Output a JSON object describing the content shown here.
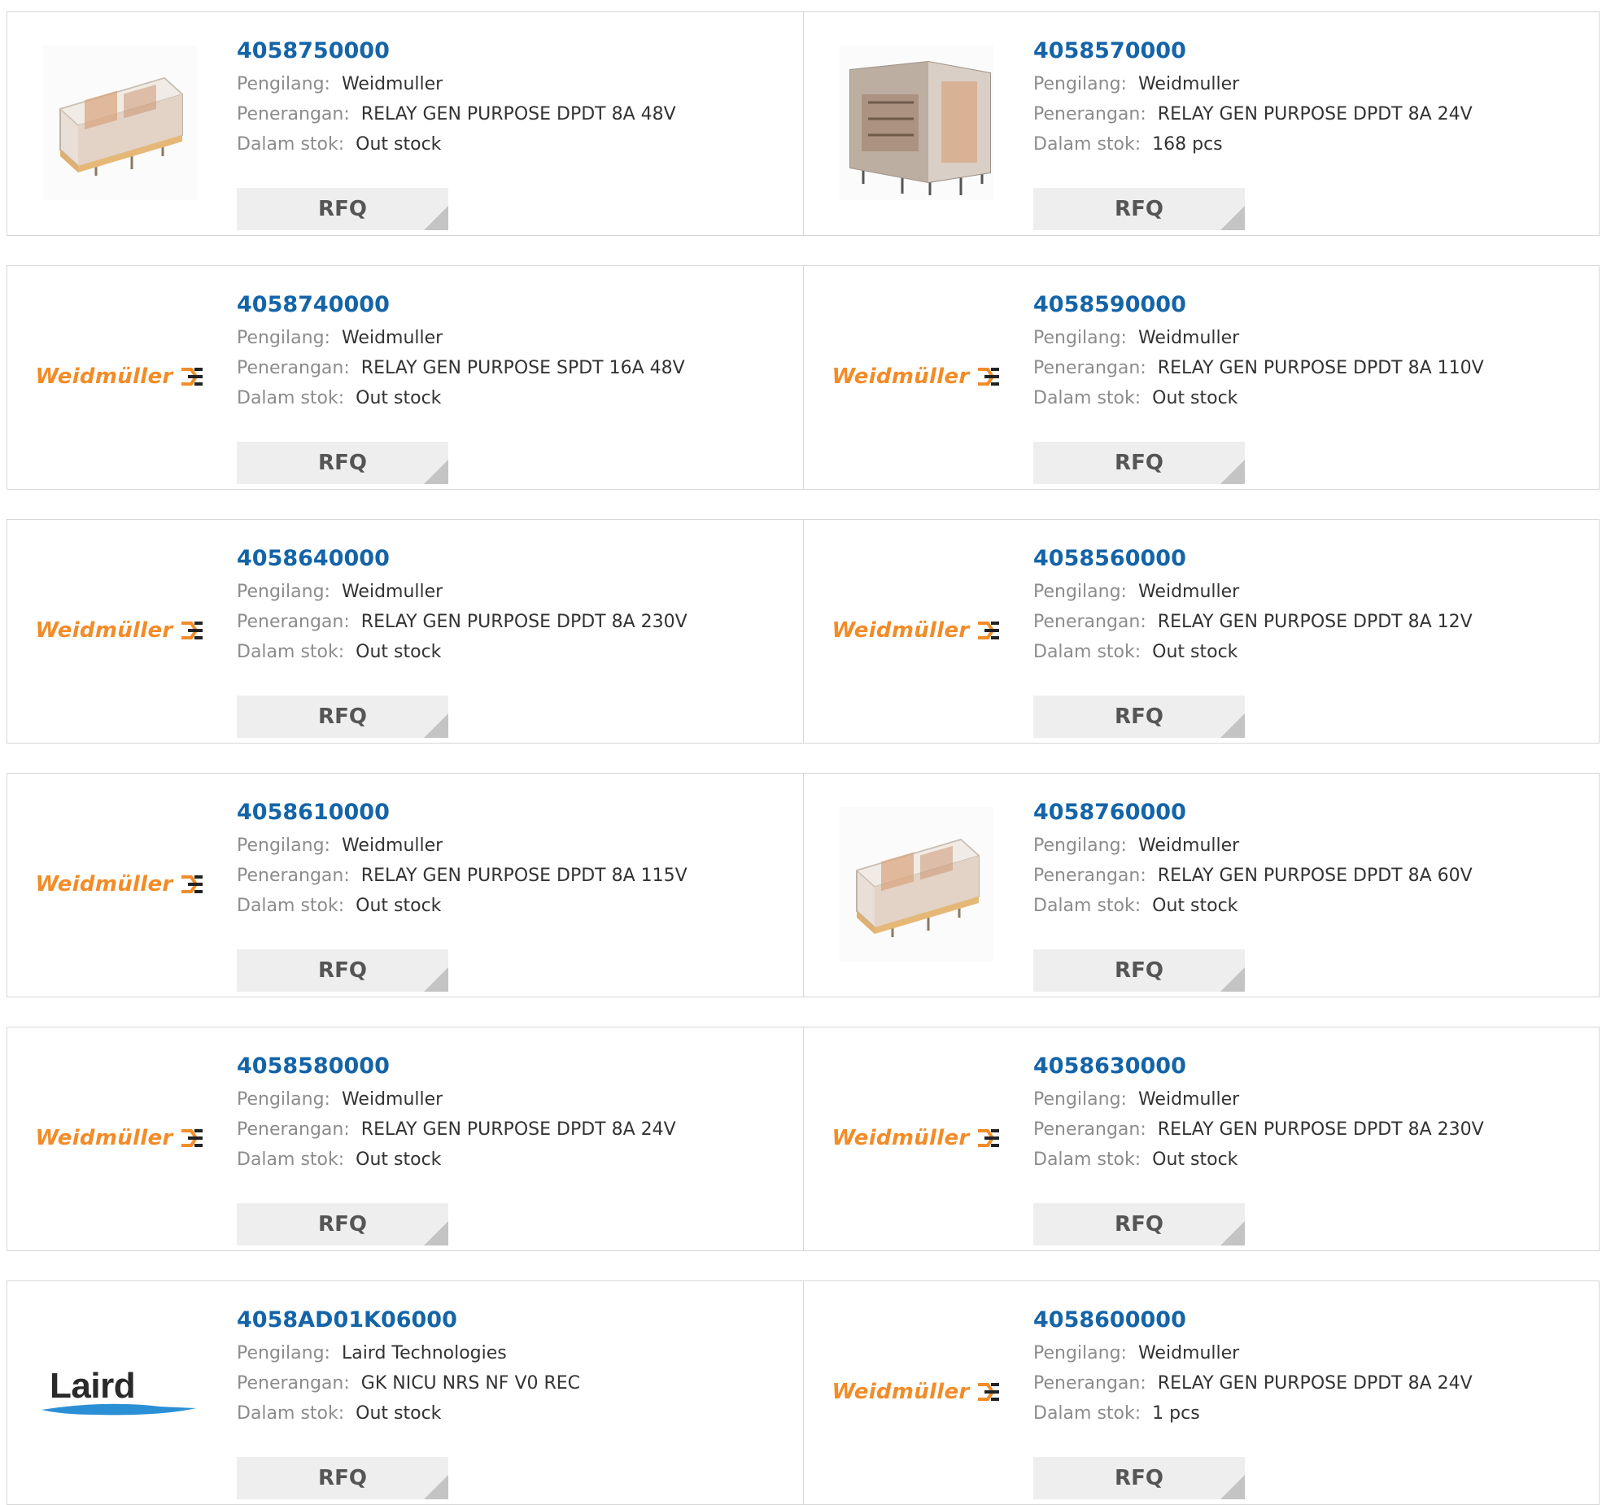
{
  "labels": {
    "manufacturer": "Pengilang:",
    "description": "Penerangan:",
    "stock": "Dalam stok:",
    "rfq": "RFQ"
  },
  "colors": {
    "part_link": "#1464a8",
    "weidmuller_orange": "#f28c28",
    "laird_swoosh": "#2b8fd6"
  },
  "logos": {
    "weidmuller": "Weidmüller",
    "laird": "Laird"
  },
  "products": [
    {
      "part": "4058750000",
      "manufacturer": "Weidmuller",
      "description": "RELAY GEN PURPOSE DPDT 8A 48V",
      "stock": "Out stock",
      "image": "relay-photo"
    },
    {
      "part": "4058570000",
      "manufacturer": "Weidmuller",
      "description": "RELAY GEN PURPOSE DPDT 8A 24V",
      "stock": "168 pcs",
      "image": "relay-photo-front"
    },
    {
      "part": "4058740000",
      "manufacturer": "Weidmuller",
      "description": "RELAY GEN PURPOSE SPDT 16A 48V",
      "stock": "Out stock",
      "image": "weidmuller-logo"
    },
    {
      "part": "4058590000",
      "manufacturer": "Weidmuller",
      "description": "RELAY GEN PURPOSE DPDT 8A 110V",
      "stock": "Out stock",
      "image": "weidmuller-logo"
    },
    {
      "part": "4058640000",
      "manufacturer": "Weidmuller",
      "description": "RELAY GEN PURPOSE DPDT 8A 230V",
      "stock": "Out stock",
      "image": "weidmuller-logo"
    },
    {
      "part": "4058560000",
      "manufacturer": "Weidmuller",
      "description": "RELAY GEN PURPOSE DPDT 8A 12V",
      "stock": "Out stock",
      "image": "weidmuller-logo"
    },
    {
      "part": "4058610000",
      "manufacturer": "Weidmuller",
      "description": "RELAY GEN PURPOSE DPDT 8A 115V",
      "stock": "Out stock",
      "image": "weidmuller-logo"
    },
    {
      "part": "4058760000",
      "manufacturer": "Weidmuller",
      "description": "RELAY GEN PURPOSE DPDT 8A 60V",
      "stock": "Out stock",
      "image": "relay-photo"
    },
    {
      "part": "4058580000",
      "manufacturer": "Weidmuller",
      "description": "RELAY GEN PURPOSE DPDT 8A 24V",
      "stock": "Out stock",
      "image": "weidmuller-logo"
    },
    {
      "part": "4058630000",
      "manufacturer": "Weidmuller",
      "description": "RELAY GEN PURPOSE DPDT 8A 230V",
      "stock": "Out stock",
      "image": "weidmuller-logo"
    },
    {
      "part": "4058AD01K06000",
      "manufacturer": "Laird Technologies",
      "description": "GK NICU NRS NF V0 REC",
      "stock": "Out stock",
      "image": "laird-logo"
    },
    {
      "part": "4058600000",
      "manufacturer": "Weidmuller",
      "description": "RELAY GEN PURPOSE DPDT 8A 24V",
      "stock": "1 pcs",
      "image": "weidmuller-logo"
    }
  ]
}
